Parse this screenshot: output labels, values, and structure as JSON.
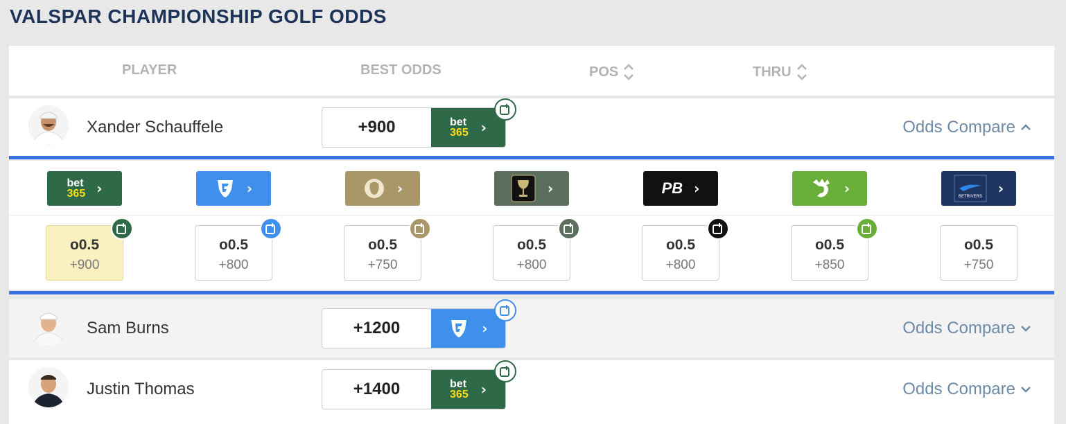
{
  "page": {
    "title": "VALSPAR CHAMPIONSHIP GOLF ODDS"
  },
  "table_header": {
    "player": "PLAYER",
    "best_odds": "BEST ODDS",
    "pos": "POS",
    "thru": "THRU"
  },
  "players": [
    {
      "name": "Xander Schauffele",
      "best_odds": "+900",
      "book": "bet365",
      "book_color": "#2e6a47",
      "odds_compare": "Odds Compare",
      "expanded": true
    },
    {
      "name": "Sam Burns",
      "best_odds": "+1200",
      "book": "fanduel",
      "book_color": "#3f90ec",
      "odds_compare": "Odds Compare",
      "expanded": false
    },
    {
      "name": "Justin Thomas",
      "best_odds": "+1400",
      "book": "bet365",
      "book_color": "#2e6a47",
      "odds_compare": "Odds Compare",
      "expanded": false
    }
  ],
  "odds_compare_books": [
    {
      "book": "bet365",
      "color": "#2e6a47",
      "line": "o0.5",
      "price": "+900",
      "best": true
    },
    {
      "book": "fanduel",
      "color": "#3f90ec",
      "line": "o0.5",
      "price": "+800",
      "best": false
    },
    {
      "book": "betmgm",
      "color": "#a99768",
      "line": "o0.5",
      "price": "+750",
      "best": false
    },
    {
      "book": "caesars",
      "color": "#5c6e5e",
      "line": "o0.5",
      "price": "+800",
      "best": false
    },
    {
      "book": "pointsbet",
      "color": "#111111",
      "line": "o0.5",
      "price": "+800",
      "best": false
    },
    {
      "book": "draftkings",
      "color": "#6aae3a",
      "line": "o0.5",
      "price": "+850",
      "best": false
    },
    {
      "book": "betrivers",
      "color": "#1e3461",
      "line": "o0.5",
      "price": "+750",
      "best": false
    }
  ],
  "logos": {
    "bet365_top": "bet",
    "bet365_bottom": "365",
    "pointsbet": "PB",
    "betrivers": "BETRIVERS"
  }
}
